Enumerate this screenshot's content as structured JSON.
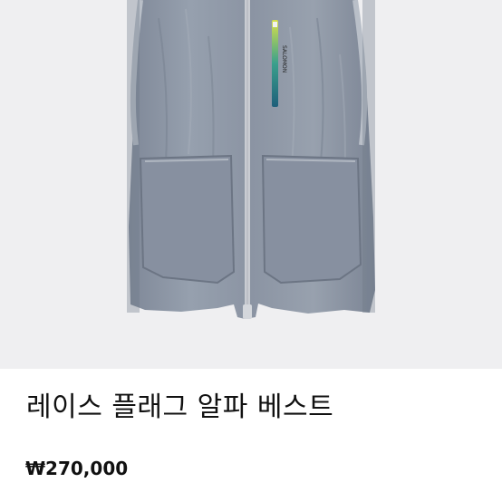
{
  "product": {
    "image_subject": "vest-image",
    "name": "레이스 플래그 알파 베스트",
    "price": "₩270,000",
    "colors": {
      "image_background": "#efeff1",
      "vest_body": "#8a93a1",
      "vest_shadow": "#6e7786",
      "zipper": "#c9ccd2",
      "pocket_accent": "#2a8f7a",
      "text": "#111111"
    }
  }
}
